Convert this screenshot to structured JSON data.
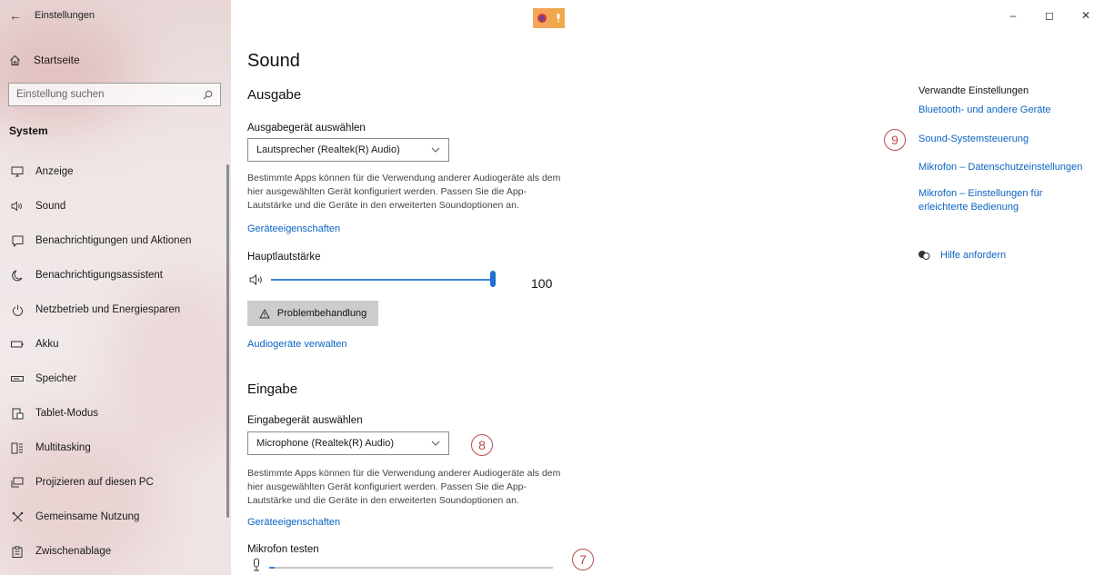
{
  "window": {
    "title": "Einstellungen",
    "controls": {
      "minimize": "–",
      "maximize": "◻",
      "close": "✕"
    }
  },
  "sidebar": {
    "home_label": "Startseite",
    "search_placeholder": "Einstellung suchen",
    "section_label": "System",
    "items": [
      {
        "label": "Anzeige",
        "icon": "monitor-icon"
      },
      {
        "label": "Sound",
        "icon": "speaker-icon"
      },
      {
        "label": "Benachrichtigungen und Aktionen",
        "icon": "notification-icon"
      },
      {
        "label": "Benachrichtigungsassistent",
        "icon": "moon-icon"
      },
      {
        "label": "Netzbetrieb und Energiesparen",
        "icon": "power-icon"
      },
      {
        "label": "Akku",
        "icon": "battery-icon"
      },
      {
        "label": "Speicher",
        "icon": "storage-icon"
      },
      {
        "label": "Tablet-Modus",
        "icon": "tablet-icon"
      },
      {
        "label": "Multitasking",
        "icon": "multitasking-icon"
      },
      {
        "label": "Projizieren auf diesen PC",
        "icon": "project-icon"
      },
      {
        "label": "Gemeinsame Nutzung",
        "icon": "share-icon"
      },
      {
        "label": "Zwischenablage",
        "icon": "clipboard-icon"
      }
    ]
  },
  "main": {
    "title": "Sound",
    "output": {
      "heading": "Ausgabe",
      "device_label": "Ausgabegerät auswählen",
      "device_value": "Lautsprecher (Realtek(R) Audio)",
      "description": "Bestimmte Apps können für die Verwendung anderer Audiogeräte als dem hier ausgewählten Gerät konfiguriert werden. Passen Sie die App-Lautstärke und die Geräte in den erweiterten Soundoptionen an.",
      "properties_link": "Geräteeigenschaften",
      "volume_label": "Hauptlautstärke",
      "volume_value": "100",
      "volume_fraction": 1.0,
      "troubleshoot_label": "Problembehandlung",
      "manage_link": "Audiogeräte verwalten"
    },
    "input": {
      "heading": "Eingabe",
      "device_label": "Eingabegerät auswählen",
      "device_value": "Microphone (Realtek(R) Audio)",
      "description": "Bestimmte Apps können für die Verwendung anderer Audiogeräte als dem hier ausgewählten Gerät konfiguriert werden. Passen Sie die App-Lautstärke und die Geräte in den erweiterten Soundoptionen an.",
      "properties_link": "Geräteeigenschaften",
      "mic_test_label": "Mikrofon testen",
      "mic_level_fraction": 0.02
    }
  },
  "related": {
    "title": "Verwandte Einstellungen",
    "links": [
      "Bluetooth- und andere Geräte",
      "Sound-Systemsteuerung",
      "Mikrofon – Datenschutzeinstellungen",
      "Mikrofon – Einstellungen für erleichterte Bedienung"
    ],
    "help_label": "Hilfe anfordern"
  },
  "annotations": {
    "badge_7": "7",
    "badge_8": "8",
    "badge_9": "9"
  },
  "colors": {
    "accent": "#0a64c2",
    "slider": "#1e6fcf",
    "annotation": "#b84a4a"
  }
}
